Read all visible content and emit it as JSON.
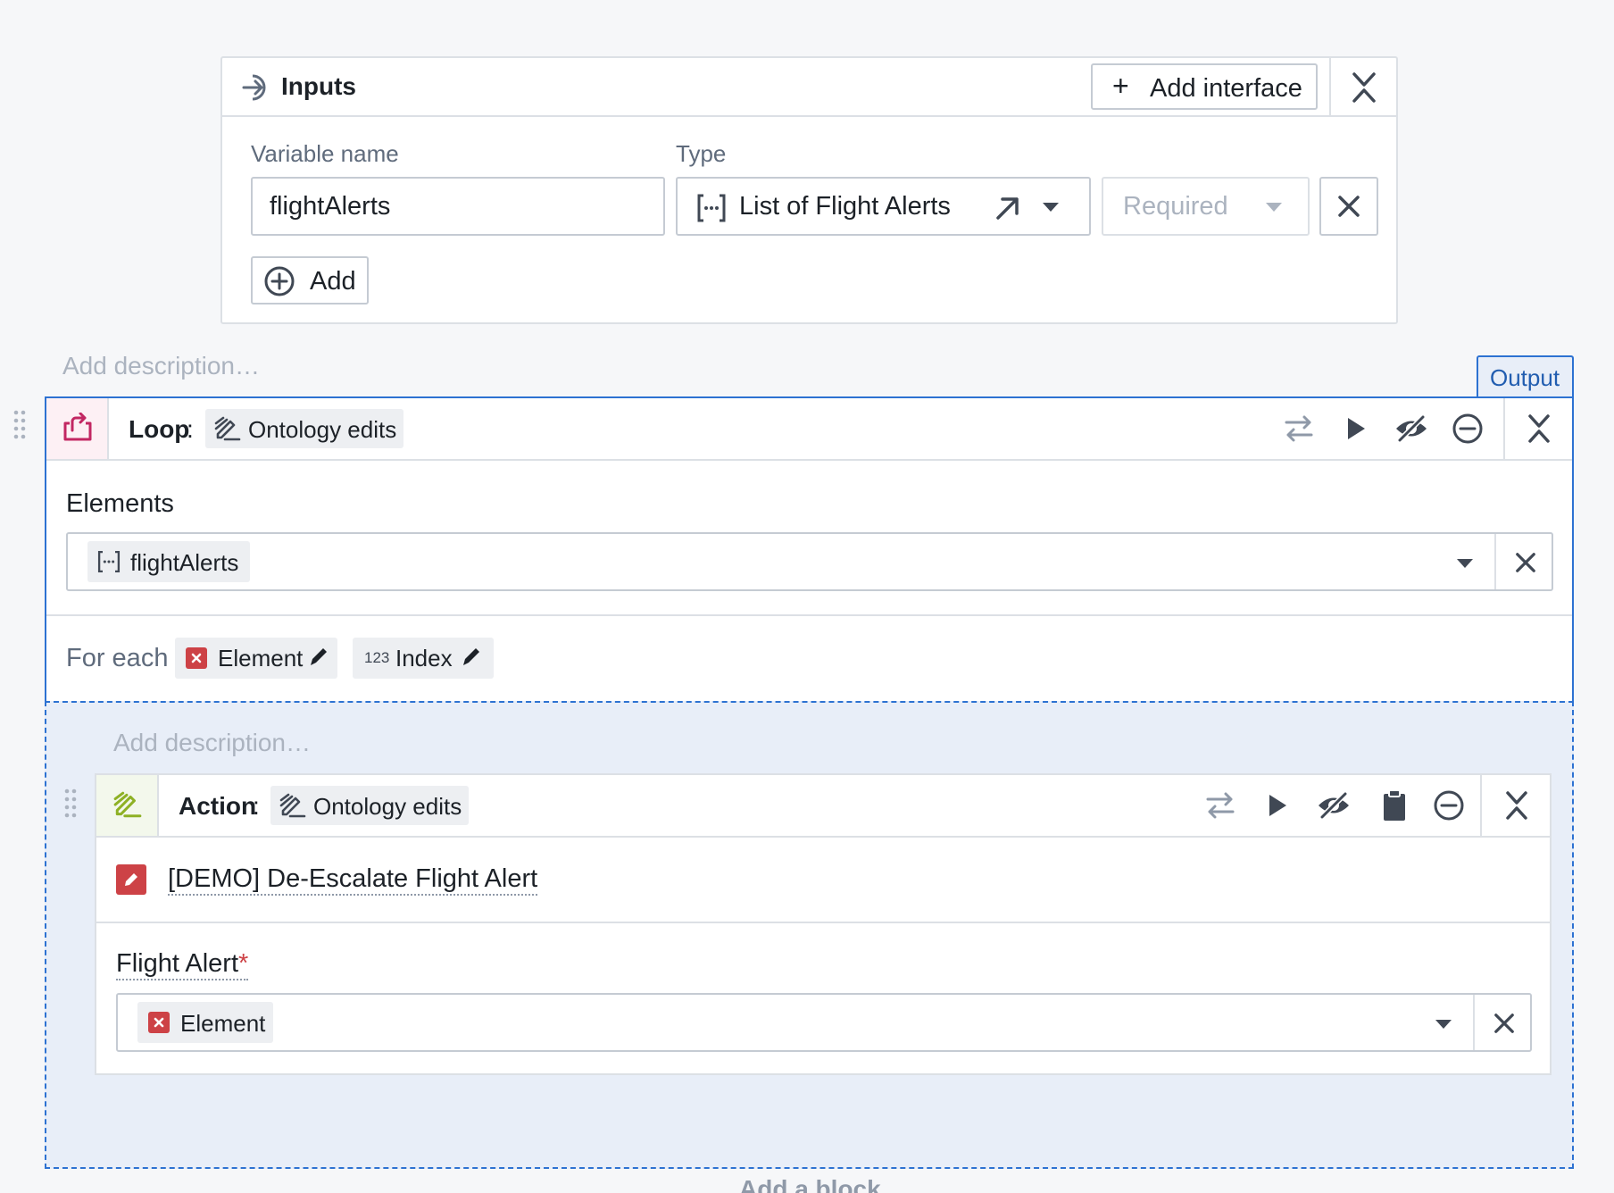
{
  "inputs": {
    "title": "Inputs",
    "add_interface_label": "Add interface",
    "variable_name_label": "Variable name",
    "type_label": "Type",
    "variable_value": "flightAlerts",
    "type_value": "List of Flight Alerts",
    "required_placeholder": "Required",
    "add_label": "Add"
  },
  "description_placeholder": "Add description…",
  "output_label": "Output",
  "loop": {
    "title": "Loop",
    "colon": ":",
    "tag": "Ontology edits",
    "elements_label": "Elements",
    "elements_value": "flightAlerts",
    "for_each_label": "For each",
    "element_var": "Element",
    "index_prefix": "123",
    "index_var": "Index"
  },
  "action": {
    "title": "Action",
    "colon": ":",
    "tag": "Ontology edits",
    "action_name": "[DEMO] De-Escalate Flight Alert",
    "param_label": "Flight Alert",
    "required_marker": "*",
    "param_value": "Element"
  },
  "add_block_label": "Add a block",
  "colors": {
    "accent": "#2d72d2",
    "loop_icon": "#c22762",
    "action_icon": "#72ca9b",
    "action_badge": "#cd4246",
    "element_badge": "#cd4246"
  }
}
